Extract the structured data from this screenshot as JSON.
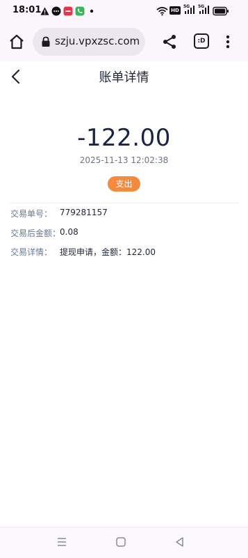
{
  "status_bar": {
    "time": "18:01",
    "icons": [
      "warning-icon",
      "chat-bubble-icon",
      "app-notification-icon",
      "phone-icon",
      "dot-icon",
      "wifi-icon",
      "hd-icon",
      "signal-5g-icon",
      "signal-5g-icon",
      "battery-icon"
    ],
    "network_label_1": "5G",
    "network_label_2": "5G",
    "hd_label": "HD"
  },
  "browser": {
    "url": "szju.vpxzsc.com",
    "tabs_label": ":D"
  },
  "header": {
    "title": "账单详情"
  },
  "transaction": {
    "amount": "-122.00",
    "datetime": "2025-11-13 12:02:38",
    "type_badge": "支出",
    "colors": {
      "badge": "#f58a3c",
      "amount": "#1b2340",
      "label": "#6a7898"
    }
  },
  "details": [
    {
      "label": "交易单号：",
      "value": "779281157"
    },
    {
      "label": "交易后金额：",
      "value": "0.08"
    },
    {
      "label": "交易详情：",
      "value": "提现申请，金额：122.00"
    }
  ]
}
